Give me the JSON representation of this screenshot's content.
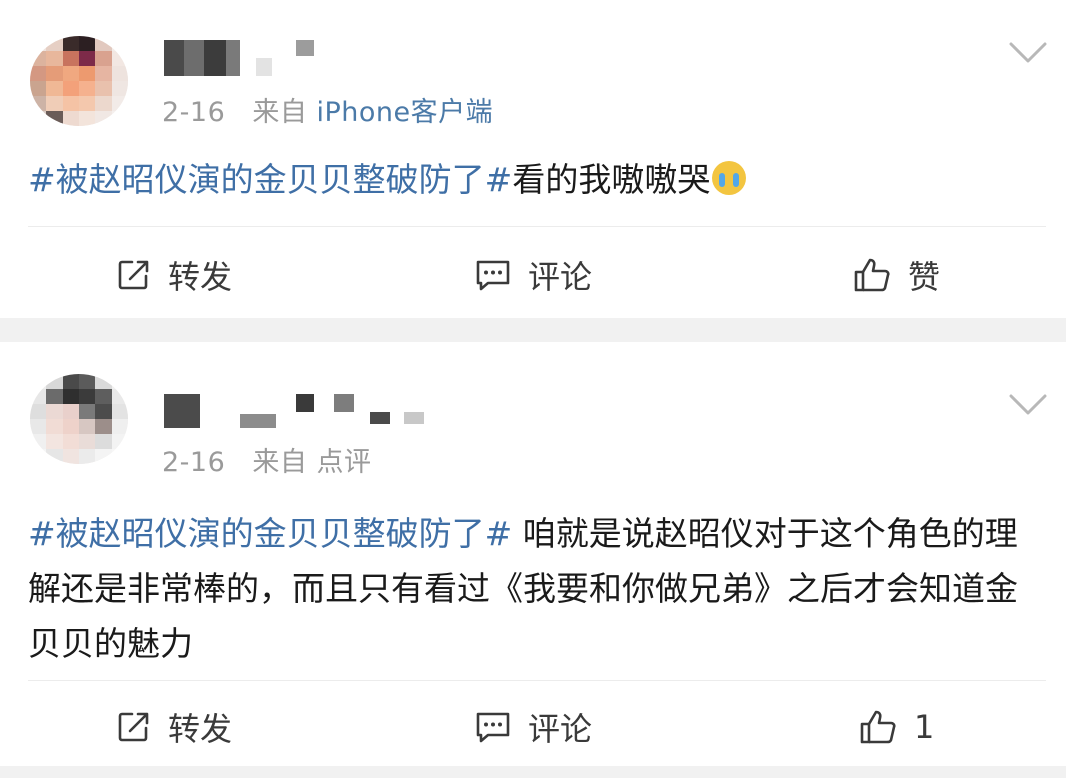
{
  "posts": [
    {
      "date": "2-16",
      "source_prefix": "来自",
      "source_app": "iPhone客户端",
      "hashtag": "#被赵昭仪演的金贝贝整破防了#",
      "body": "看的我嗷嗷哭",
      "emoji_icon": "crying-face-icon",
      "actions": {
        "repost": "转发",
        "comment": "评论",
        "like": "赞"
      }
    },
    {
      "date": "2-16",
      "source_prefix": "来自",
      "source_app": "点评",
      "hashtag": "#被赵昭仪演的金贝贝整破防了#",
      "body": " 咱就是说赵昭仪对于这个角色的理解还是非常棒的，而且只有看过《我要和你做兄弟》之后才会知道金贝贝的魅力",
      "actions": {
        "repost": "转发",
        "comment": "评论",
        "like": "1"
      }
    }
  ],
  "colors": {
    "hashtag": "#3f6fa6",
    "meta": "#9a9a9a",
    "separator": "#f1f1f1"
  }
}
